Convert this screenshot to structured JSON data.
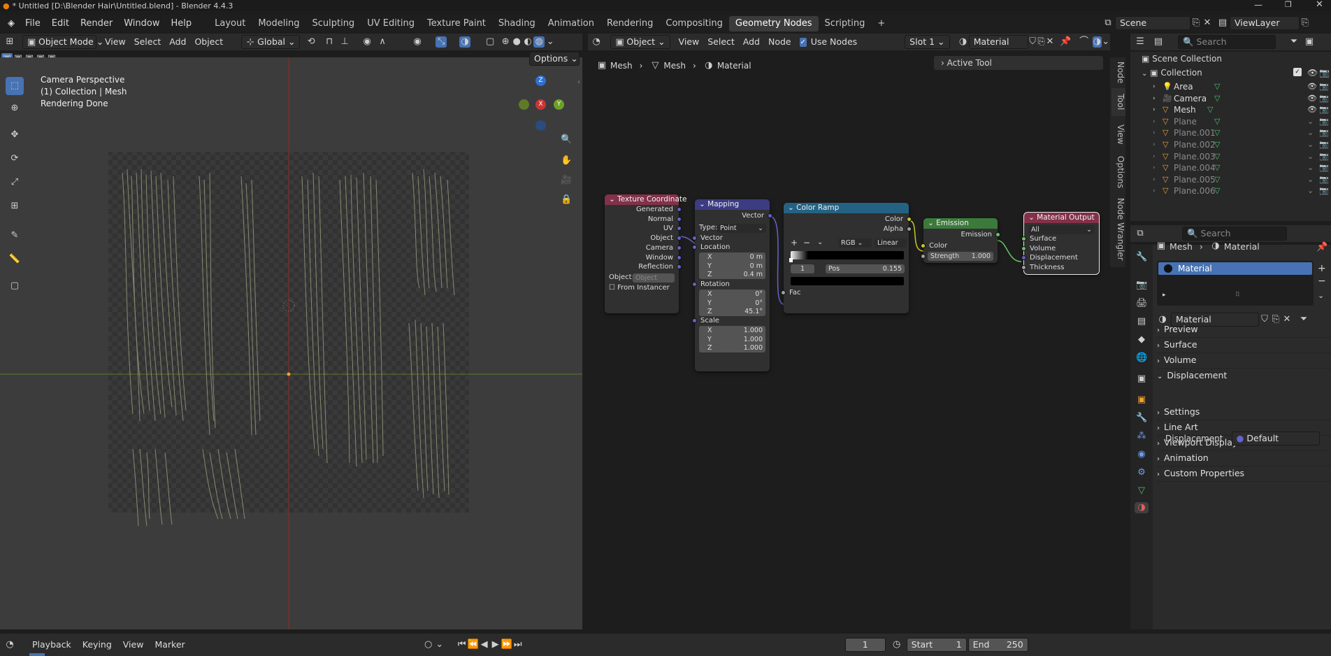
{
  "window": {
    "title": "* Untitled [D:\\Blender Hair\\Untitled.blend] - Blender 4.4.3"
  },
  "menu": [
    "File",
    "Edit",
    "Render",
    "Window",
    "Help"
  ],
  "workspaces": [
    "Layout",
    "Modeling",
    "Sculpting",
    "UV Editing",
    "Texture Paint",
    "Shading",
    "Animation",
    "Rendering",
    "Compositing",
    "Geometry Nodes",
    "Scripting"
  ],
  "active_workspace": "Geometry Nodes",
  "scene": {
    "name": "Scene",
    "view_layer": "ViewLayer"
  },
  "viewport": {
    "mode": "Object Mode",
    "menus": [
      "View",
      "Select",
      "Add",
      "Object"
    ],
    "transform": "Global",
    "options_label": "Options",
    "overlay_lines": [
      "Camera Perspective",
      "(1) Collection | Mesh",
      "Rendering Done"
    ],
    "gizmo": {
      "z": "Z",
      "x": "X",
      "y": "Y"
    }
  },
  "node_editor": {
    "type": "Object",
    "menus": [
      "View",
      "Select",
      "Add",
      "Node"
    ],
    "use_nodes_label": "Use Nodes",
    "slot": "Slot 1",
    "material": "Material",
    "breadcrumb": [
      "Mesh",
      "Mesh",
      "Material"
    ],
    "active_tool": "Active Tool",
    "side_tabs": [
      "Node",
      "Tool",
      "View",
      "Options",
      "Node Wrangler"
    ],
    "nodes": {
      "texcoord": {
        "title": "Texture Coordinate",
        "outputs": [
          "Generated",
          "Normal",
          "UV",
          "Object",
          "Camera",
          "Window",
          "Reflection"
        ],
        "object_label": "Object:",
        "object_placeholder": "Object",
        "from_instancer": "From Instancer"
      },
      "mapping": {
        "title": "Mapping",
        "output": "Vector",
        "type_label": "Type:",
        "type_value": "Point",
        "vector": "Vector",
        "location": "Location",
        "loc": [
          {
            "a": "X",
            "v": "0 m"
          },
          {
            "a": "Y",
            "v": "0 m"
          },
          {
            "a": "Z",
            "v": "0.4 m"
          }
        ],
        "rotation": "Rotation",
        "rot": [
          {
            "a": "X",
            "v": "0°"
          },
          {
            "a": "Y",
            "v": "0°"
          },
          {
            "a": "Z",
            "v": "45.1°"
          }
        ],
        "scale": "Scale",
        "scl": [
          {
            "a": "X",
            "v": "1.000"
          },
          {
            "a": "Y",
            "v": "1.000"
          },
          {
            "a": "Z",
            "v": "1.000"
          }
        ]
      },
      "colorramp": {
        "title": "Color Ramp",
        "outputs": [
          "Color",
          "Alpha"
        ],
        "color_mode": "RGB",
        "interp": "Linear",
        "stop_index": "1",
        "pos_label": "Pos",
        "pos_value": "0.155",
        "fac": "Fac"
      },
      "emission": {
        "title": "Emission",
        "output": "Emission",
        "color": "Color",
        "strength_label": "Strength",
        "strength_value": "1.000"
      },
      "output": {
        "title": "Material Output",
        "target": "All",
        "inputs": [
          "Surface",
          "Volume",
          "Displacement",
          "Thickness"
        ]
      }
    }
  },
  "outliner": {
    "search_placeholder": "Search",
    "root": "Scene Collection",
    "collection": "Collection",
    "items": [
      "Area",
      "Camera",
      "Mesh",
      "Plane",
      "Plane.001",
      "Plane.002",
      "Plane.003",
      "Plane.004",
      "Plane.005",
      "Plane.006"
    ]
  },
  "properties": {
    "search_placeholder": "Search",
    "breadcrumb": [
      "Mesh",
      "Material"
    ],
    "slot": "Material",
    "material_name": "Material",
    "panels": [
      "Preview",
      "Surface",
      "Volume",
      "Displacement",
      "Settings",
      "Line Art",
      "Viewport Display",
      "Animation",
      "Custom Properties"
    ],
    "displacement_label": "Displacement",
    "displacement_value": "Default"
  },
  "timeline": {
    "menus": [
      "Playback",
      "Keying",
      "View",
      "Marker"
    ],
    "frame": "1",
    "start_label": "Start",
    "start": "1",
    "end_label": "End",
    "end": "250"
  },
  "colors": {
    "accent": "#4772b3",
    "texcoord": "#83314a",
    "mapping": "#3c3c83",
    "colorramp": "#246283",
    "emission": "#3c7a3c",
    "output": "#83314a",
    "vector_socket": "#6363c7",
    "color_socket": "#c7c729",
    "float_socket": "#a1a1a1",
    "shader_socket": "#63c763"
  }
}
